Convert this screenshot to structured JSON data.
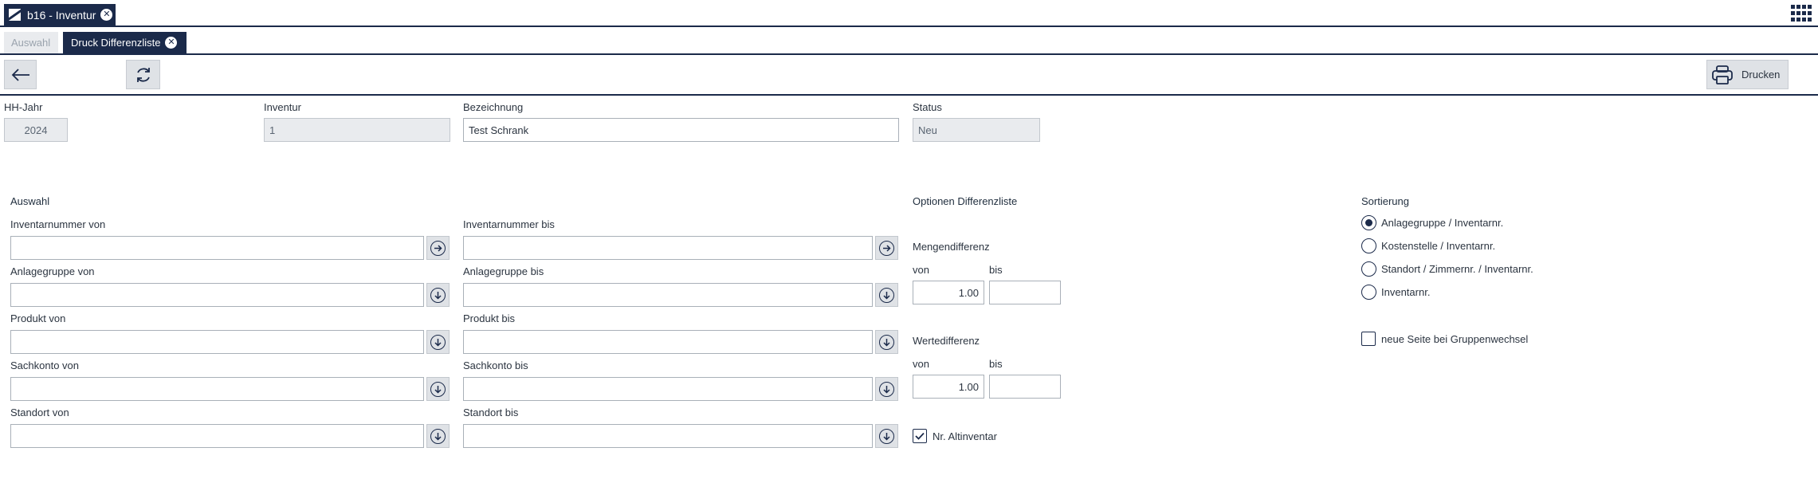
{
  "window": {
    "tab_title": "b16 - Inventur"
  },
  "subtabs": {
    "inactive": "Auswahl",
    "active": "Druck Differenzliste"
  },
  "toolbar": {
    "print_label": "Drucken"
  },
  "header": {
    "hh_jahr": {
      "label": "HH-Jahr",
      "value": "2024"
    },
    "inventur": {
      "label": "Inventur",
      "value": "1"
    },
    "bezeichnung": {
      "label": "Bezeichnung",
      "value": "Test Schrank"
    },
    "status": {
      "label": "Status",
      "value": "Neu"
    }
  },
  "auswahl": {
    "title": "Auswahl",
    "rows": [
      {
        "from_label": "Inventarnummer von",
        "to_label": "Inventarnummer bis",
        "from_value": "",
        "to_value": "",
        "button": "arrow-right"
      },
      {
        "from_label": "Anlagegruppe von",
        "to_label": "Anlagegruppe bis",
        "from_value": "",
        "to_value": "",
        "button": "arrow-down"
      },
      {
        "from_label": "Produkt von",
        "to_label": "Produkt bis",
        "from_value": "",
        "to_value": "",
        "button": "arrow-down"
      },
      {
        "from_label": "Sachkonto von",
        "to_label": "Sachkonto bis",
        "from_value": "",
        "to_value": "",
        "button": "arrow-down"
      },
      {
        "from_label": "Standort von",
        "to_label": "Standort bis",
        "from_value": "",
        "to_value": "",
        "button": "arrow-down"
      }
    ]
  },
  "optionen": {
    "title": "Optionen Differenzliste",
    "mengendifferenz": {
      "label": "Mengendifferenz",
      "von_label": "von",
      "bis_label": "bis",
      "von_value": "1.00",
      "bis_value": ""
    },
    "wertedifferenz": {
      "label": "Wertedifferenz",
      "von_label": "von",
      "bis_label": "bis",
      "von_value": "1.00",
      "bis_value": ""
    },
    "altinventar": {
      "label": "Nr. Altinventar",
      "checked": true
    }
  },
  "sortierung": {
    "title": "Sortierung",
    "options": [
      {
        "label": "Anlagegruppe / Inventarnr.",
        "selected": true
      },
      {
        "label": "Kostenstelle / Inventarnr.",
        "selected": false
      },
      {
        "label": "Standort / Zimmernr. / Inventarnr.",
        "selected": false
      },
      {
        "label": "Inventarnr.",
        "selected": false
      }
    ],
    "neue_seite": {
      "label": "neue Seite bei Gruppenwechsel",
      "checked": false
    }
  },
  "colors": {
    "primary": "#1b2a4a",
    "readonly_bg": "#e9ebee",
    "button_bg": "#dfe2e6"
  }
}
